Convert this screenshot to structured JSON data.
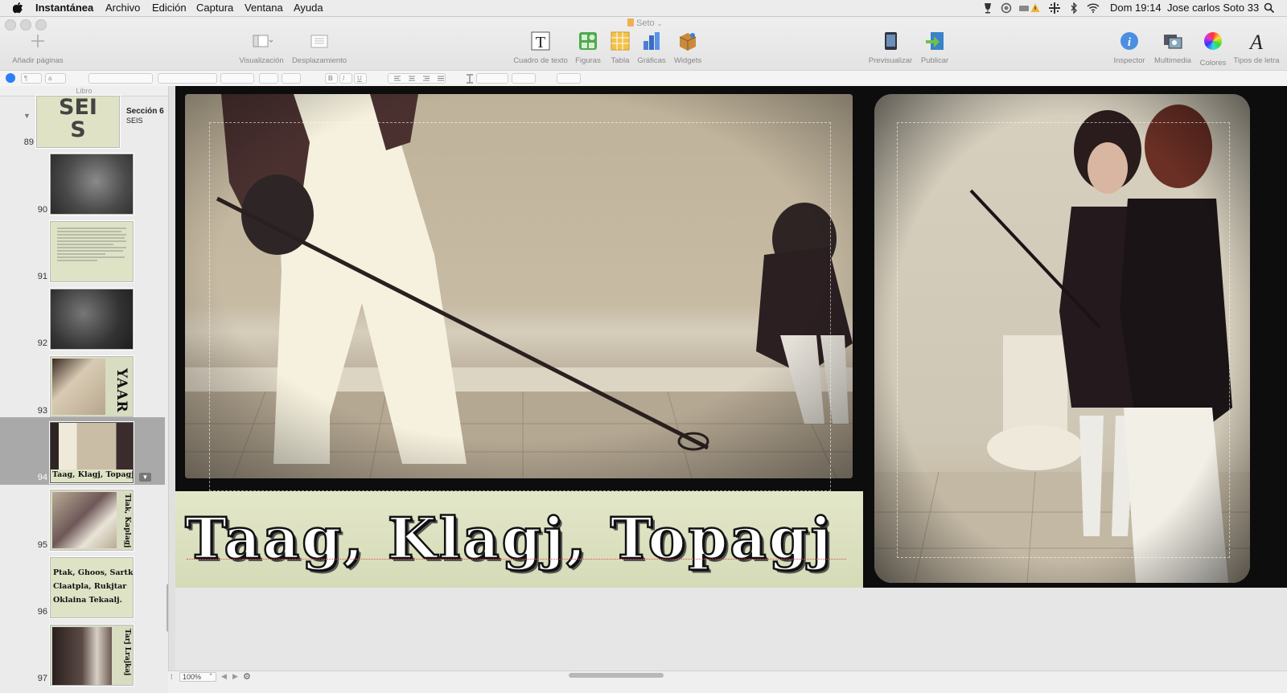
{
  "menubar": {
    "app_name": "Instantánea",
    "menus": [
      "Archivo",
      "Edición",
      "Captura",
      "Ventana",
      "Ayuda"
    ],
    "clock": "Dom 19:14",
    "user": "Jose carlos Soto 33"
  },
  "window": {
    "title": "Seto"
  },
  "toolbar": {
    "add_pages": "Añadir páginas",
    "view": "Visualización",
    "wrap": "Desplazamiento",
    "textbox": "Cuadro de texto",
    "shapes": "Figuras",
    "table": "Tabla",
    "charts": "Gráficas",
    "widgets": "Widgets",
    "preview": "Previsualizar",
    "publish": "Publicar",
    "inspector": "Inspector",
    "media": "Multimedia",
    "colors": "Colores",
    "fonts": "Tipos de letra"
  },
  "formatbar": {
    "paragraph": "¶",
    "char": "a",
    "bold": "B",
    "italic": "I",
    "underline": "U"
  },
  "sidebar": {
    "header": "Libro",
    "section": {
      "title": "Sección 6",
      "subtitle": "SEIS",
      "thumb_text_1": "SEI",
      "thumb_text_2": "S"
    },
    "pages": [
      "89",
      "90",
      "91",
      "92",
      "93",
      "94",
      "95",
      "96",
      "97"
    ],
    "thumb93_text": "YAAR",
    "thumb94_caption": "Taag, Klagj, Topagj",
    "thumb95_text": "Tlak, Kaplagj",
    "thumb96_lines": [
      "Ptak, Ghoos, Sartk",
      "Claatpla, Rukjtar",
      "Oklaina Tekaalj."
    ],
    "thumb97_text": "Tarj Lrajkaj"
  },
  "page": {
    "caption": "Taag, Klagj, Topagj"
  },
  "statusbar": {
    "zoom": "100%"
  },
  "colors": {
    "caption_band": "#dde2c2",
    "selection": "#a9a9a9",
    "accent": "#2d7ff9"
  }
}
